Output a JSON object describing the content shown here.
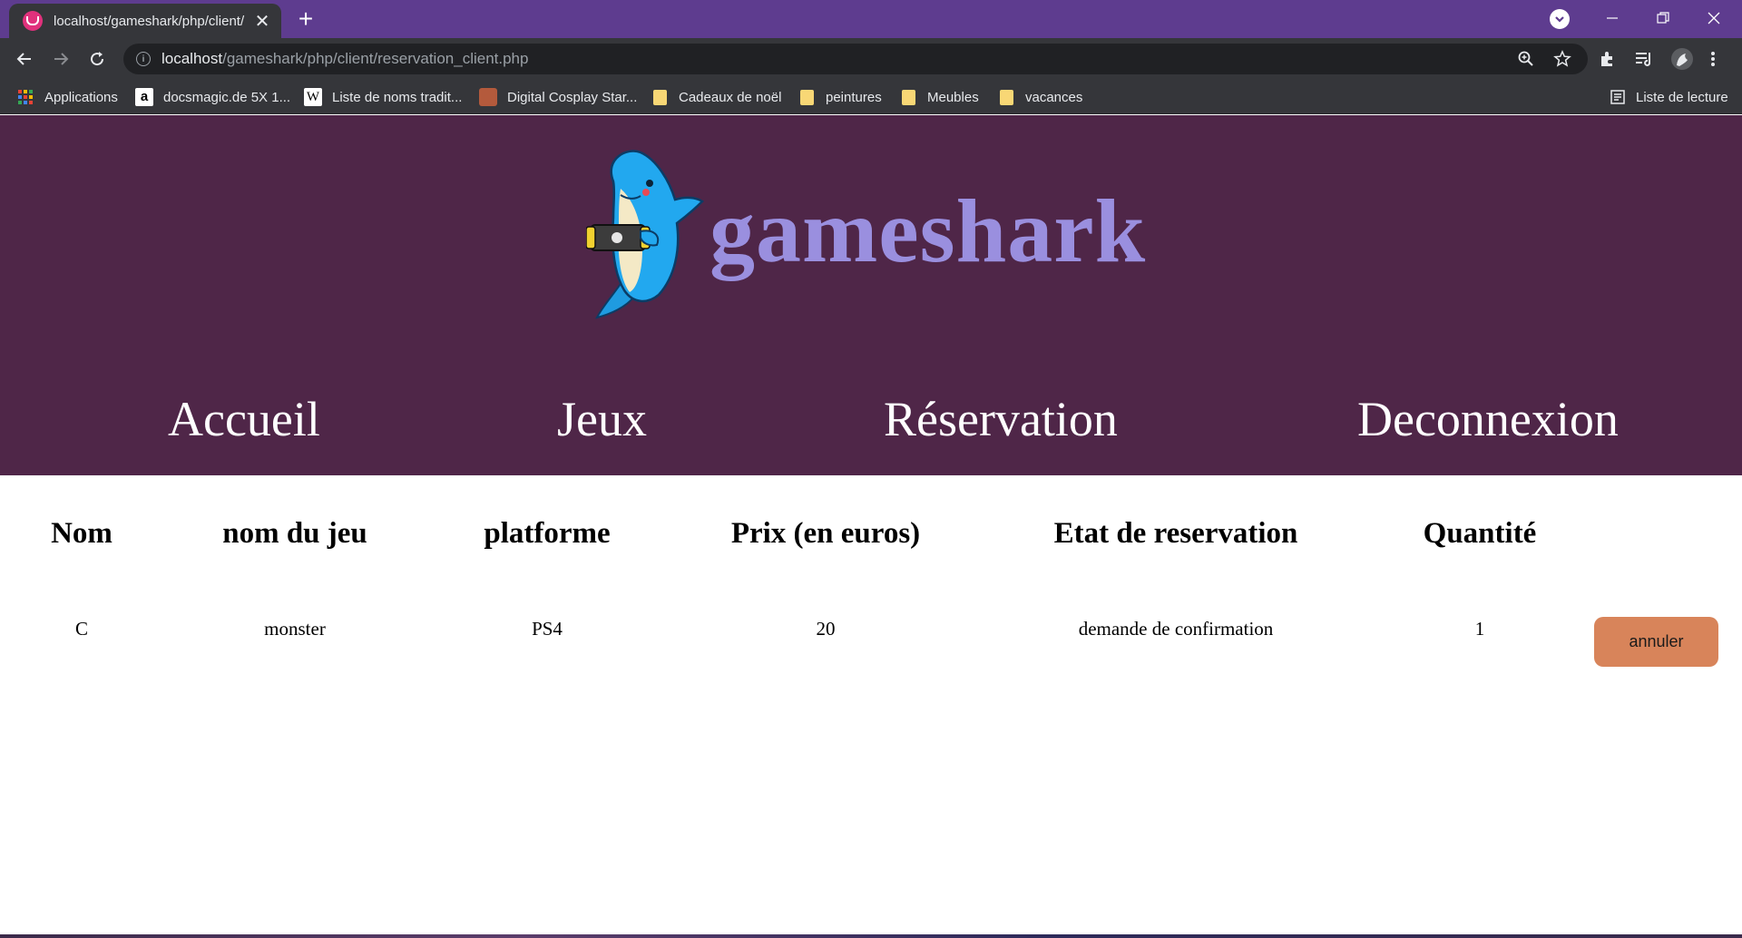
{
  "browser": {
    "tab_title": "localhost/gameshark/php/client/",
    "url_host": "localhost",
    "url_path": "/gameshark/php/client/reservation_client.php",
    "bookmarks": [
      {
        "label": "Applications",
        "icon": "apps-grid-icon"
      },
      {
        "label": "docsmagic.de 5X 1...",
        "icon": "amazon-icon"
      },
      {
        "label": "Liste de noms tradit...",
        "icon": "wikipedia-icon"
      },
      {
        "label": "Digital Cosplay Star...",
        "icon": "cosplay-icon"
      },
      {
        "label": "Cadeaux de noël",
        "icon": "folder-icon"
      },
      {
        "label": "peintures",
        "icon": "folder-icon"
      },
      {
        "label": "Meubles",
        "icon": "folder-icon"
      },
      {
        "label": "vacances",
        "icon": "folder-icon"
      }
    ],
    "reading_list": "Liste de lecture"
  },
  "site": {
    "brand": "gameshark",
    "nav": [
      "Accueil",
      "Jeux",
      "Réservation",
      "Deconnexion"
    ]
  },
  "table": {
    "headers": [
      "Nom",
      "nom du jeu",
      "platforme",
      "Prix (en euros)",
      "Etat de reservation",
      "Quantité"
    ],
    "rows": [
      {
        "nom": "C",
        "jeu": "monster",
        "platforme": "PS4",
        "prix": "20",
        "etat": "demande de confirmation",
        "quantite": "1",
        "action": "annuler"
      }
    ]
  },
  "colors": {
    "tabstrip": "#5e3c8f",
    "header_bg": "#4f2648",
    "brand": "#9a8fdf",
    "cancel_button": "#d8845a"
  }
}
